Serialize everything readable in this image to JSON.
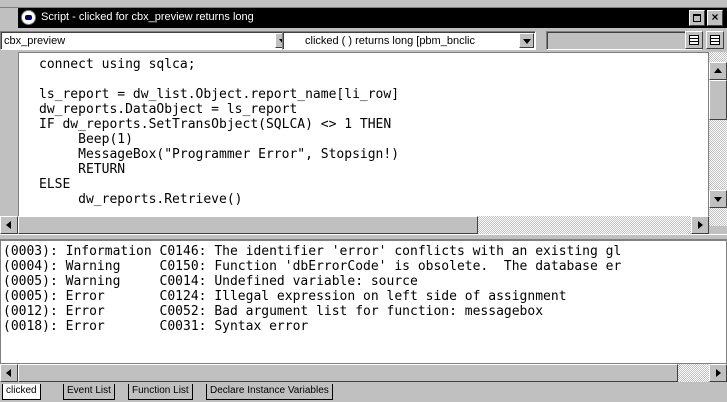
{
  "window": {
    "title": "Script - clicked for cbx_preview returns long"
  },
  "toolbar": {
    "object_combo": "cbx_preview",
    "event_combo": "clicked ( ) returns long [pbm_bnclic",
    "third_combo": ""
  },
  "editor": {
    "code": "connect using sqlca;\n\nls_report = dw_list.Object.report_name[li_row]\ndw_reports.DataObject = ls_report\nIF dw_reports.SetTransObject(SQLCA) <> 1 THEN\n     Beep(1)\n     MessageBox(\"Programmer Error\", Stopsign!)\n     RETURN\nELSE\n     dw_reports.Retrieve()"
  },
  "messages": [
    "(0003): Information C0146: The identifier 'error' conflicts with an existing gl",
    "(0004): Warning     C0150: Function 'dbErrorCode' is obsolete.  The database er",
    "(0005): Warning     C0014: Undefined variable: source",
    "(0005): Error       C0124: Illegal expression on left side of assignment",
    "(0012): Error       C0052: Bad argument list for function: messagebox",
    "(0018): Error       C0031: Syntax error"
  ],
  "tabs": [
    {
      "label": "clicked"
    },
    {
      "label": "Event List"
    },
    {
      "label": "Function List"
    },
    {
      "label": "Declare Instance Variables"
    }
  ],
  "colors": {
    "titlebar_bg": "#000000",
    "face": "#c0c0c0",
    "editor_bg": "#ffffff"
  }
}
